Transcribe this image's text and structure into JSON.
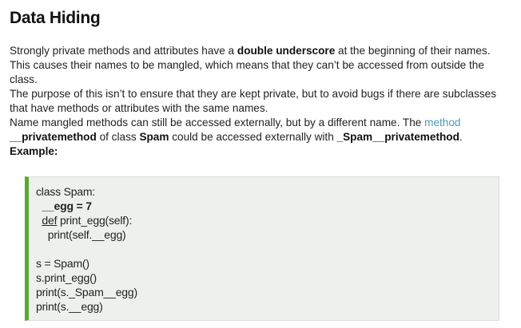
{
  "title": "Data Hiding",
  "para1": {
    "t1": "Strongly private methods and attributes have a ",
    "b1": "double underscore",
    "t2": " at the beginning of their names. This causes their names to be mangled, which means that they can’t be accessed from outside the class."
  },
  "para2": {
    "t1": "The purpose of this isn’t to ensure that they are kept private, but to avoid bugs if there are subclasses that have methods or attributes with the same names."
  },
  "para3": {
    "t1": "Name mangled methods can still be accessed externally, but by a different name. The ",
    "link": "method",
    "b1": "__privatemethod",
    "t2": " of class ",
    "b2": "Spam",
    "t3": " could be accessed externally with ",
    "b3": "_Spam__privatemethod",
    "t4": "."
  },
  "example_label": "Example:",
  "code": {
    "line1": "class Spam:",
    "line2": "  __egg = 7",
    "line3_kw": "def",
    "line3_rest": " print_egg(self):",
    "line4": "    print(self.__egg)",
    "line5": "s = Spam()",
    "line6": "s.print_egg()",
    "line7": "print(s._Spam__egg)",
    "line8": "print(s.__egg)"
  },
  "colors": {
    "link": "#4a9bb5",
    "code_bg": "#eef0ee",
    "code_accent": "#5aa832"
  }
}
